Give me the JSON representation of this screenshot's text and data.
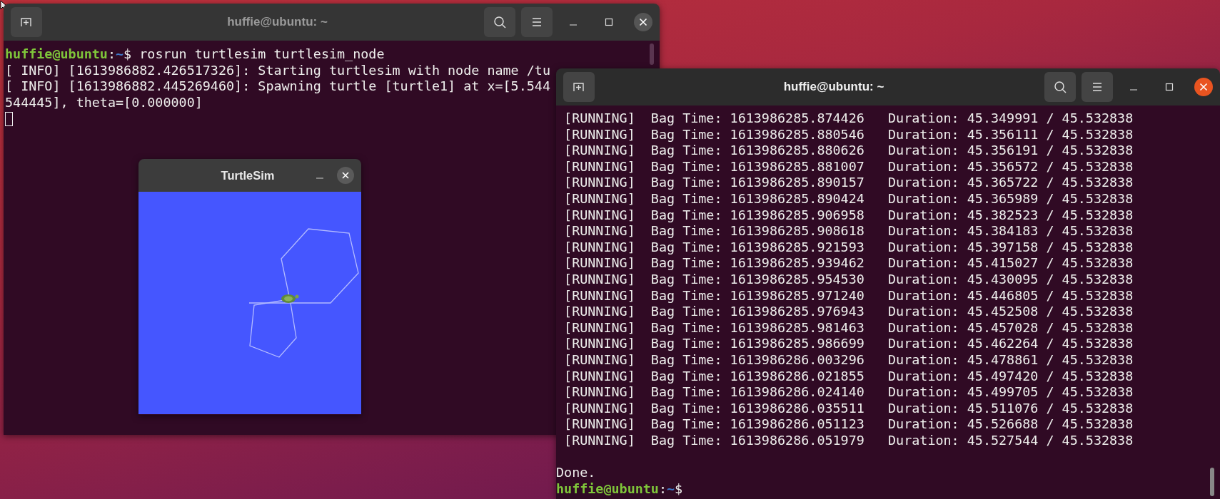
{
  "windows": [
    {
      "kind": "terminal",
      "title": "huffie@ubuntu: ~",
      "focused": false,
      "lines": [
        {
          "kind": "prompt",
          "user_host": "huffie@ubuntu",
          "separator": ":",
          "path": "~",
          "symbol": "$",
          "command": "rosrun turtlesim turtlesim_node"
        },
        {
          "kind": "output",
          "text": "[ INFO] [1613986882.426517326]: Starting turtlesim with node name /tu"
        },
        {
          "kind": "output",
          "text": "[ INFO] [1613986882.445269460]: Spawning turtle [turtle1] at x=[5.544"
        },
        {
          "kind": "output",
          "text": "544445], theta=[0.000000]"
        },
        {
          "kind": "cursor"
        }
      ]
    },
    {
      "kind": "turtlesim",
      "title": "TurtleSim",
      "focused": false
    },
    {
      "kind": "terminal",
      "title": "huffie@ubuntu: ~",
      "focused": true,
      "lines": [
        {
          "kind": "output",
          "text": " [RUNNING]  Bag Time: 1613986285.874426   Duration: 45.349991 / 45.532838"
        },
        {
          "kind": "output",
          "text": " [RUNNING]  Bag Time: 1613986285.880546   Duration: 45.356111 / 45.532838"
        },
        {
          "kind": "output",
          "text": " [RUNNING]  Bag Time: 1613986285.880626   Duration: 45.356191 / 45.532838"
        },
        {
          "kind": "output",
          "text": " [RUNNING]  Bag Time: 1613986285.881007   Duration: 45.356572 / 45.532838"
        },
        {
          "kind": "output",
          "text": " [RUNNING]  Bag Time: 1613986285.890157   Duration: 45.365722 / 45.532838"
        },
        {
          "kind": "output",
          "text": " [RUNNING]  Bag Time: 1613986285.890424   Duration: 45.365989 / 45.532838"
        },
        {
          "kind": "output",
          "text": " [RUNNING]  Bag Time: 1613986285.906958   Duration: 45.382523 / 45.532838"
        },
        {
          "kind": "output",
          "text": " [RUNNING]  Bag Time: 1613986285.908618   Duration: 45.384183 / 45.532838"
        },
        {
          "kind": "output",
          "text": " [RUNNING]  Bag Time: 1613986285.921593   Duration: 45.397158 / 45.532838"
        },
        {
          "kind": "output",
          "text": " [RUNNING]  Bag Time: 1613986285.939462   Duration: 45.415027 / 45.532838"
        },
        {
          "kind": "output",
          "text": " [RUNNING]  Bag Time: 1613986285.954530   Duration: 45.430095 / 45.532838"
        },
        {
          "kind": "output",
          "text": " [RUNNING]  Bag Time: 1613986285.971240   Duration: 45.446805 / 45.532838"
        },
        {
          "kind": "output",
          "text": " [RUNNING]  Bag Time: 1613986285.976943   Duration: 45.452508 / 45.532838"
        },
        {
          "kind": "output",
          "text": " [RUNNING]  Bag Time: 1613986285.981463   Duration: 45.457028 / 45.532838"
        },
        {
          "kind": "output",
          "text": " [RUNNING]  Bag Time: 1613986285.986699   Duration: 45.462264 / 45.532838"
        },
        {
          "kind": "output",
          "text": " [RUNNING]  Bag Time: 1613986286.003296   Duration: 45.478861 / 45.532838"
        },
        {
          "kind": "output",
          "text": " [RUNNING]  Bag Time: 1613986286.021855   Duration: 45.497420 / 45.532838"
        },
        {
          "kind": "output",
          "text": " [RUNNING]  Bag Time: 1613986286.024140   Duration: 45.499705 / 45.532838"
        },
        {
          "kind": "output",
          "text": " [RUNNING]  Bag Time: 1613986286.035511   Duration: 45.511076 / 45.532838"
        },
        {
          "kind": "output",
          "text": " [RUNNING]  Bag Time: 1613986286.051123   Duration: 45.526688 / 45.532838"
        },
        {
          "kind": "output",
          "text": " [RUNNING]  Bag Time: 1613986286.051979   Duration: 45.527544 / 45.532838"
        },
        {
          "kind": "blank"
        },
        {
          "kind": "output",
          "text": "Done."
        },
        {
          "kind": "prompt",
          "user_host": "huffie@ubuntu",
          "separator": ":",
          "path": "~",
          "symbol": "$"
        }
      ]
    }
  ]
}
